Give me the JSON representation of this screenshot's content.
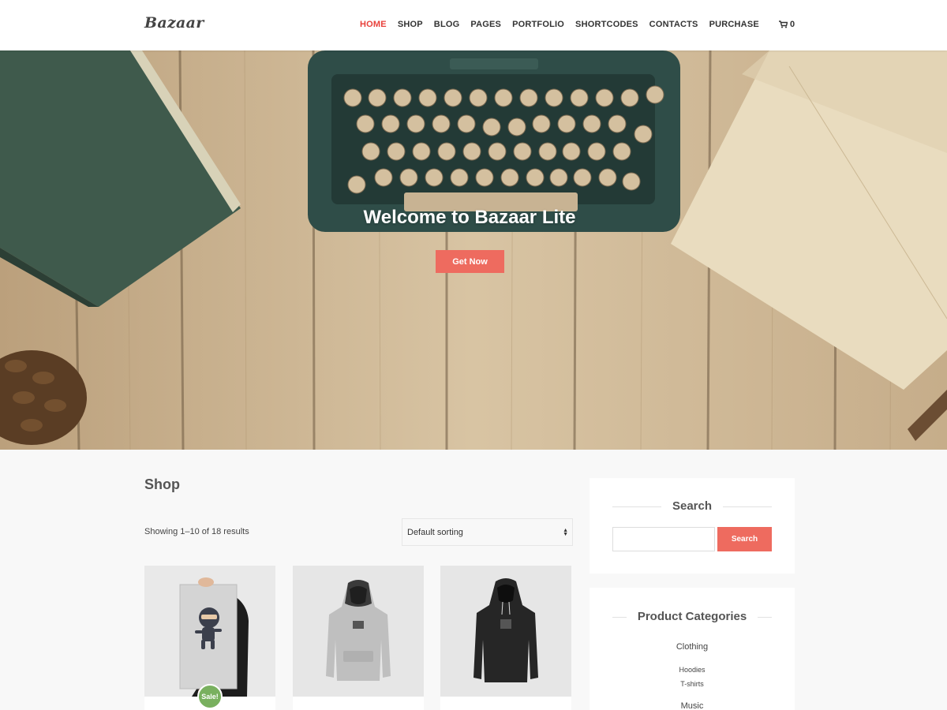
{
  "header": {
    "logo": "Bazaar",
    "nav": [
      "HOME",
      "SHOP",
      "BLOG",
      "PAGES",
      "PORTFOLIO",
      "SHORTCODES",
      "CONTACTS",
      "PURCHASE"
    ],
    "active_nav": "HOME",
    "cart_count": "0",
    "accent_color": "#e8413b"
  },
  "hero": {
    "title": "Welcome to Bazaar Lite",
    "button_label": "Get Now",
    "button_color": "#ee6b5f"
  },
  "shop": {
    "title": "Shop",
    "result_count": "Showing 1–10 of 18 results",
    "sort_selected": "Default sorting",
    "sale_badge": "Sale!",
    "sale_color": "#79b05f"
  },
  "sidebar": {
    "search_title": "Search",
    "search_placeholder": "",
    "search_button": "Search",
    "categories_title": "Product Categories",
    "categories": {
      "clothing": "Clothing",
      "hoodies": "Hoodies",
      "tshirts": "T-shirts",
      "music": "Music"
    }
  }
}
